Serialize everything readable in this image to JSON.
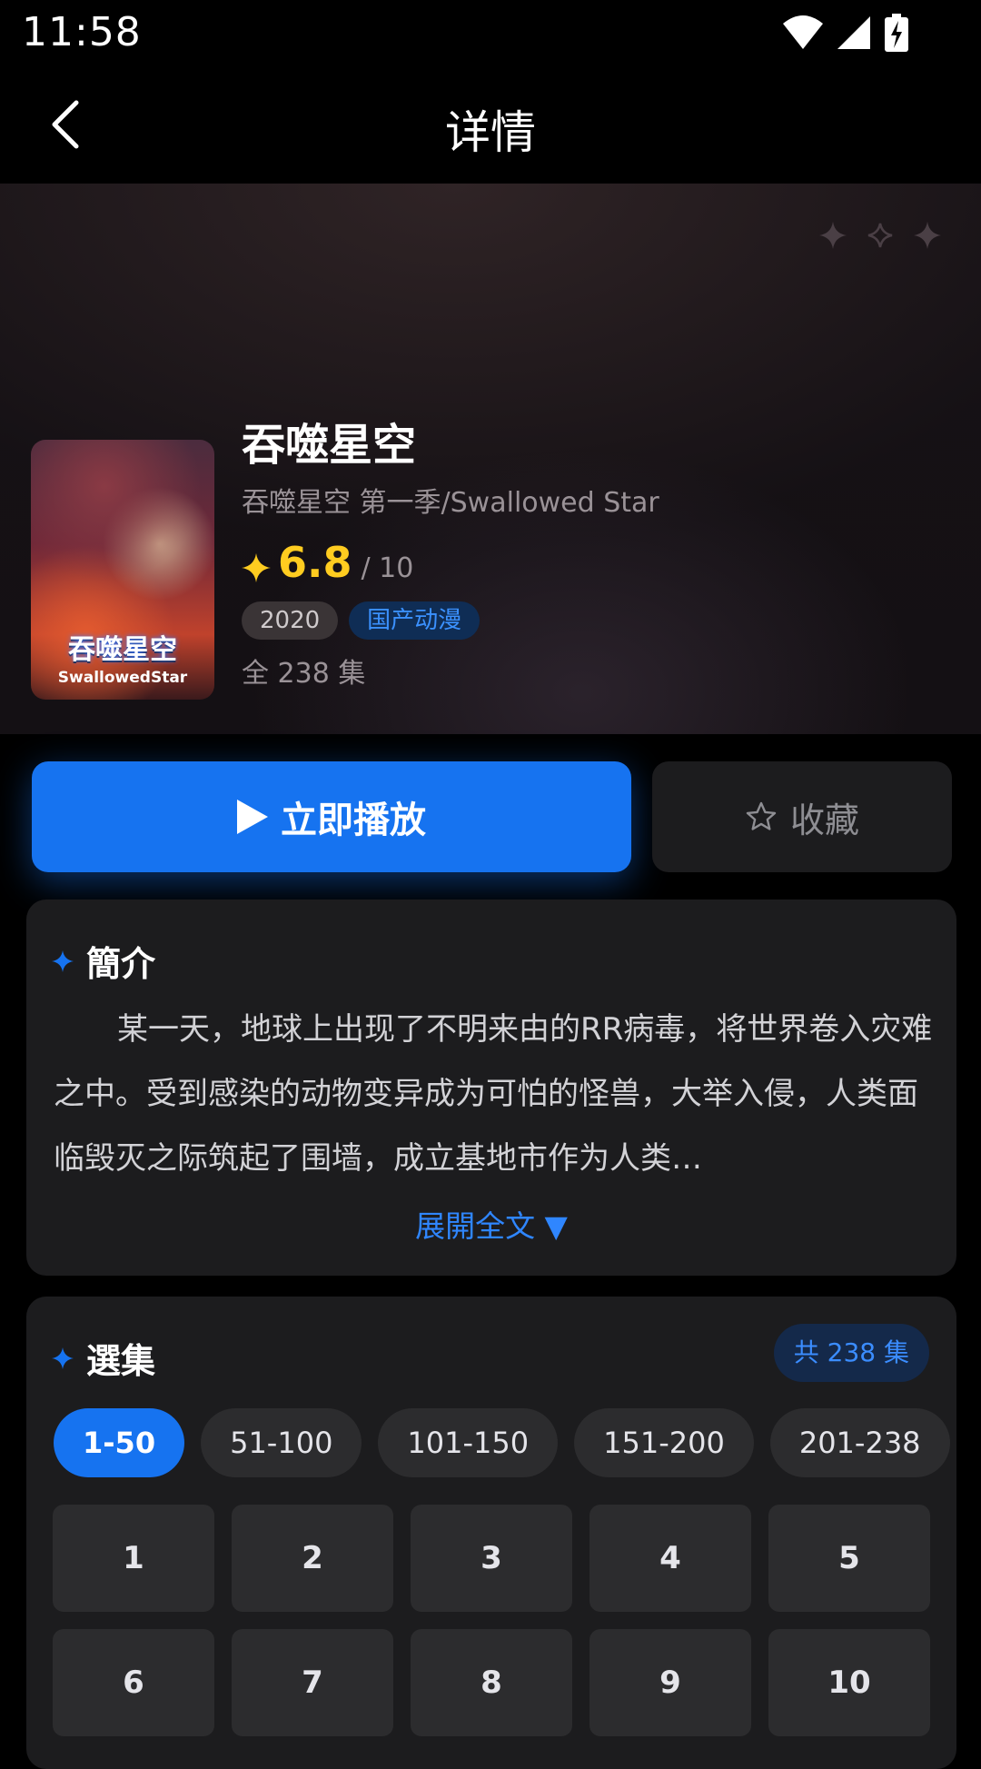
{
  "status_bar": {
    "time": "11:58"
  },
  "header": {
    "title": "详情"
  },
  "show": {
    "title": "吞噬星空",
    "subtitle": "吞噬星空 第一季/Swallowed Star",
    "rating": "6.8",
    "rating_max": "/ 10",
    "year": "2020",
    "genre": "国产动漫",
    "episodes_total": "全 238 集",
    "poster_title": "吞噬星空",
    "poster_subtitle": "SwallowedStar"
  },
  "actions": {
    "play_label": "立即播放",
    "favorite_label": "收藏"
  },
  "synopsis": {
    "heading": "簡介",
    "text": "某一天，地球上出现了不明来由的RR病毒，将世界卷入灾难之中。受到感染的动物变异成为可怕的怪兽，大举入侵，人类面临毁灭之际筑起了围墙，成立基地市作为人类…",
    "expand_label": "展開全文 ▼"
  },
  "episodes": {
    "heading": "選集",
    "count_label": "共 238 集",
    "ranges": [
      "1-50",
      "51-100",
      "101-150",
      "151-200",
      "201-238"
    ],
    "active_range": "1-50",
    "items": [
      "1",
      "2",
      "3",
      "4",
      "5",
      "6",
      "7",
      "8",
      "9",
      "10"
    ]
  },
  "colors": {
    "accent": "#1673f0",
    "rating": "#ffcc20",
    "card": "#1c1c1e"
  }
}
